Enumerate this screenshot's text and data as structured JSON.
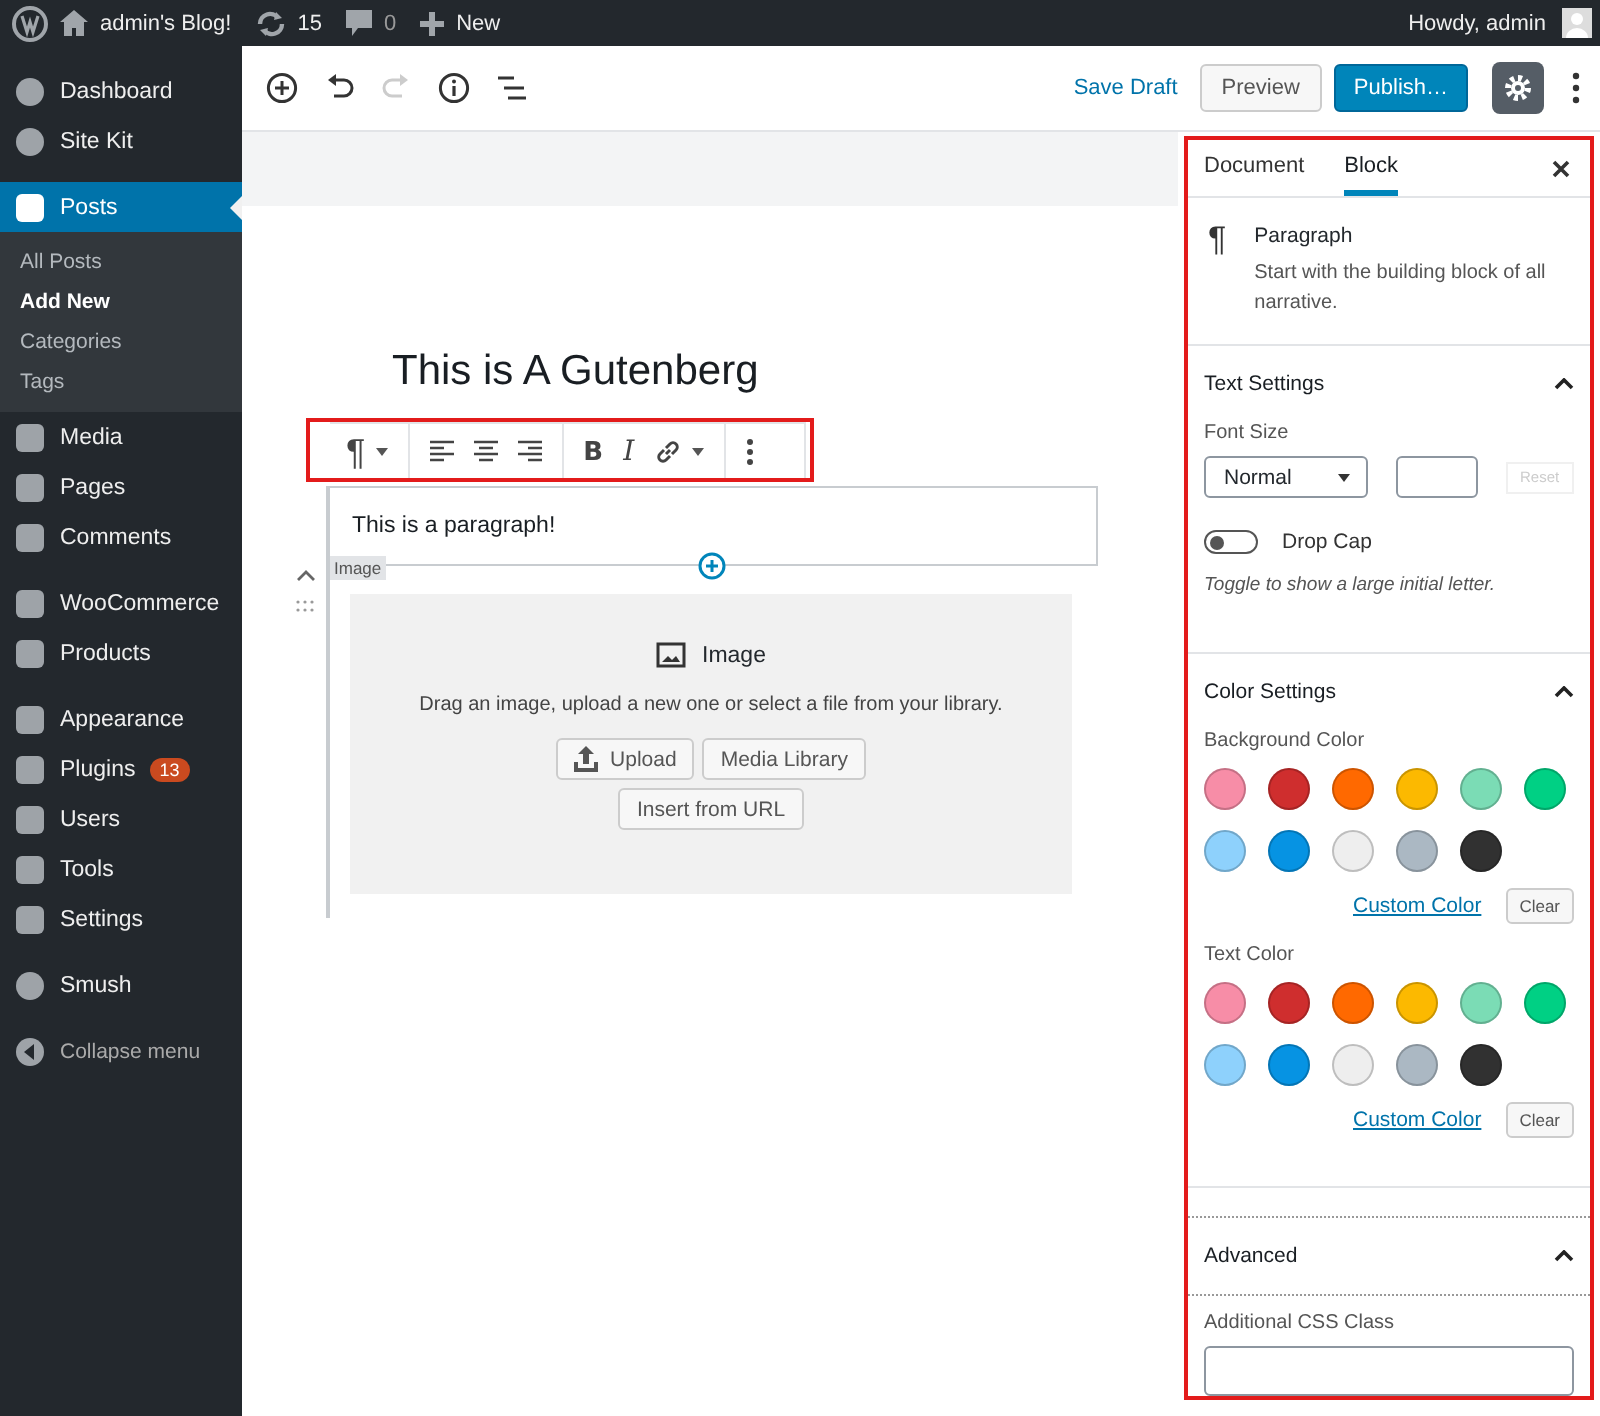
{
  "admin_bar": {
    "site": "admin's Blog!",
    "updates": "15",
    "comments": "0",
    "new": "New",
    "greeting": "Howdy, admin"
  },
  "menu_groups": [
    {
      "items": [
        {
          "label": "Dashboard",
          "selected": false
        },
        {
          "label": "Site Kit",
          "selected": false
        }
      ]
    },
    {
      "items": [
        {
          "label": "Posts",
          "selected": true,
          "children": [
            {
              "label": "All Posts",
              "selected": false
            },
            {
              "label": "Add New",
              "selected": true
            },
            {
              "label": "Categories",
              "selected": false
            },
            {
              "label": "Tags",
              "selected": false
            }
          ]
        },
        {
          "label": "Media",
          "selected": false
        },
        {
          "label": "Pages",
          "selected": false
        },
        {
          "label": "Comments",
          "selected": false
        }
      ]
    },
    {
      "items": [
        {
          "label": "WooCommerce",
          "selected": false
        },
        {
          "label": "Products",
          "selected": false
        }
      ]
    },
    {
      "items": [
        {
          "label": "Appearance",
          "selected": false
        },
        {
          "label": "Plugins",
          "selected": false,
          "badge": "13"
        },
        {
          "label": "Users",
          "selected": false
        },
        {
          "label": "Tools",
          "selected": false
        },
        {
          "label": "Settings",
          "selected": false
        }
      ]
    },
    {
      "items": [
        {
          "label": "Smush",
          "selected": false
        }
      ]
    }
  ],
  "collapse": "Collapse menu",
  "header": {
    "save_draft": "Save Draft",
    "preview": "Preview",
    "publish": "Publish…"
  },
  "post": {
    "title": "This is A Gutenberg",
    "paragraph": "This is a paragraph!",
    "next_block_label": "Image"
  },
  "block_toolbar": {
    "block_type": "¶",
    "bold": "B",
    "italic": "I"
  },
  "image_block": {
    "title": "Image",
    "instructions": "Drag an image, upload a new one or select a file from your library.",
    "upload": "Upload",
    "media_library": "Media Library",
    "insert_url": "Insert from URL"
  },
  "sidebar": {
    "tabs": [
      {
        "label": "Document",
        "selected": false
      },
      {
        "label": "Block",
        "selected": true
      }
    ],
    "block": {
      "icon": "¶",
      "name": "Paragraph",
      "description": "Start with the building block of all narrative."
    },
    "text_settings": {
      "title": "Text Settings",
      "expanded": true,
      "font_size_label": "Font Size",
      "font_size": "Normal",
      "reset": "Reset",
      "drop_cap": {
        "label": "Drop Cap",
        "on": false
      },
      "help": "Toggle to show a large initial letter."
    },
    "color_settings": {
      "title": "Color Settings",
      "expanded": true,
      "groups": [
        {
          "label": "Background Color",
          "custom": "Custom Color",
          "clear": "Clear",
          "swatches": [
            {
              "color": "#f78da7"
            },
            {
              "color": "#cf2e2e"
            },
            {
              "color": "#ff6900"
            },
            {
              "color": "#fcb900"
            },
            {
              "color": "#7bdcb5"
            },
            {
              "color": "#00d084"
            },
            {
              "color": "#8ed1fc"
            },
            {
              "color": "#0693e3"
            },
            {
              "color": "#eeeeee"
            },
            {
              "color": "#abb8c3"
            },
            {
              "color": "#313131"
            }
          ]
        },
        {
          "label": "Text Color",
          "custom": "Custom Color",
          "clear": "Clear",
          "swatches": [
            {
              "color": "#f78da7"
            },
            {
              "color": "#cf2e2e"
            },
            {
              "color": "#ff6900"
            },
            {
              "color": "#fcb900"
            },
            {
              "color": "#7bdcb5"
            },
            {
              "color": "#00d084"
            },
            {
              "color": "#8ed1fc"
            },
            {
              "color": "#0693e3"
            },
            {
              "color": "#eeeeee"
            },
            {
              "color": "#abb8c3"
            },
            {
              "color": "#313131"
            }
          ]
        }
      ]
    },
    "advanced": {
      "title": "Advanced",
      "expanded": true,
      "css_class_label": "Additional CSS Class"
    }
  }
}
